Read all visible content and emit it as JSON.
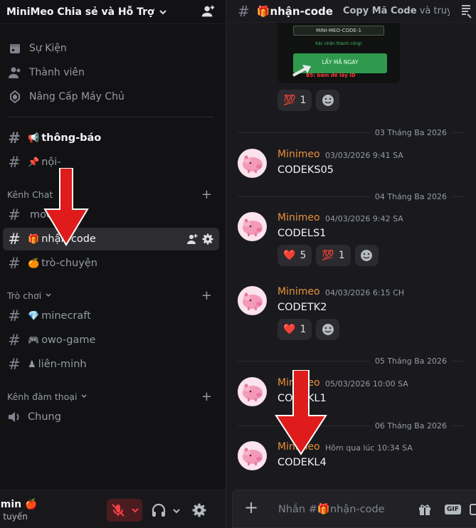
{
  "server": {
    "name": "MiniMeo Chia sẻ và Hỗ Trợ"
  },
  "top_nav": [
    {
      "label": "Sự Kiện",
      "icon": "calendar-icon"
    },
    {
      "label": "Thành viên",
      "icon": "members-icon"
    },
    {
      "label": "Nâng Cấp Máy Chủ",
      "icon": "boost-icon"
    }
  ],
  "channels_top": [
    {
      "emoji": "📢",
      "label": "thông-báo"
    },
    {
      "emoji": "📌",
      "label": "nội-"
    }
  ],
  "categories": {
    "chat": "Kênh Chat",
    "games": "Trò chơi",
    "voice": "Kênh đàm thoại"
  },
  "channels_chat": [
    {
      "emoji": "",
      "label": "mod"
    },
    {
      "emoji": "🎁",
      "label": "nhận-code"
    },
    {
      "emoji": "🍊",
      "label": "trò-chuyện"
    }
  ],
  "channels_games": [
    {
      "emoji": "💎",
      "label": "minecraft"
    },
    {
      "emoji": "🎮",
      "label": "owo-game"
    },
    {
      "emoji": "♟",
      "label": "liên-minh"
    }
  ],
  "voice_channels": [
    {
      "label": "Chung"
    }
  ],
  "user": {
    "name": "lmin 🍎",
    "status": "c tuyến"
  },
  "channel_header": {
    "hash": "#",
    "emoji": "🎁",
    "title": "nhận-code",
    "topic_bold": "Copy Mã Code",
    "topic_rest": " và truy ..."
  },
  "image_card": {
    "code_box": "MINI-MEO-CODE-1",
    "confirm": "Xác nhận thành công!",
    "button": "LẤY MÃ NGAY",
    "hint": "B5: bấm để lấy ID"
  },
  "reactions_first": [
    {
      "emoji": "💯",
      "count": "1"
    }
  ],
  "messages": [
    {
      "date": "03 Tháng Ba 2026",
      "author": "Minimeo",
      "time": "03/03/2026 9:41 SA",
      "text": "CODEKS05",
      "reactions": []
    },
    {
      "date": "04 Tháng Ba 2026",
      "author": "Minimeo",
      "time": "04/03/2026 9:42 SA",
      "text": "CODELS1",
      "reactions": [
        {
          "emoji": "❤️",
          "count": "5"
        },
        {
          "emoji": "💯",
          "count": "1"
        }
      ]
    },
    {
      "date": "",
      "author": "Minimeo",
      "time": "04/03/2026 6:15 CH",
      "text": "CODETK2",
      "reactions": [
        {
          "emoji": "❤️",
          "count": "1"
        }
      ]
    },
    {
      "date": "05 Tháng Ba 2026",
      "author": "Minimeo",
      "time": "05/03/2026 10:00 SA",
      "text": "CODEKL1",
      "reactions": []
    },
    {
      "date": "06 Tháng Ba 2026",
      "author": "Minimeo",
      "time": "Hôm qua lúc 10:34 SA",
      "text": "CODEKL4",
      "reactions": []
    }
  ],
  "composer": {
    "placeholder_prefix": "Nhắn #",
    "emoji": "🎁",
    "placeholder_channel": "nhận-code",
    "gif": "GIF"
  },
  "colors": {
    "accent_author": "#e8903a",
    "annotation_arrow": "#e01b1b",
    "mic_muted": "#f23f43"
  }
}
